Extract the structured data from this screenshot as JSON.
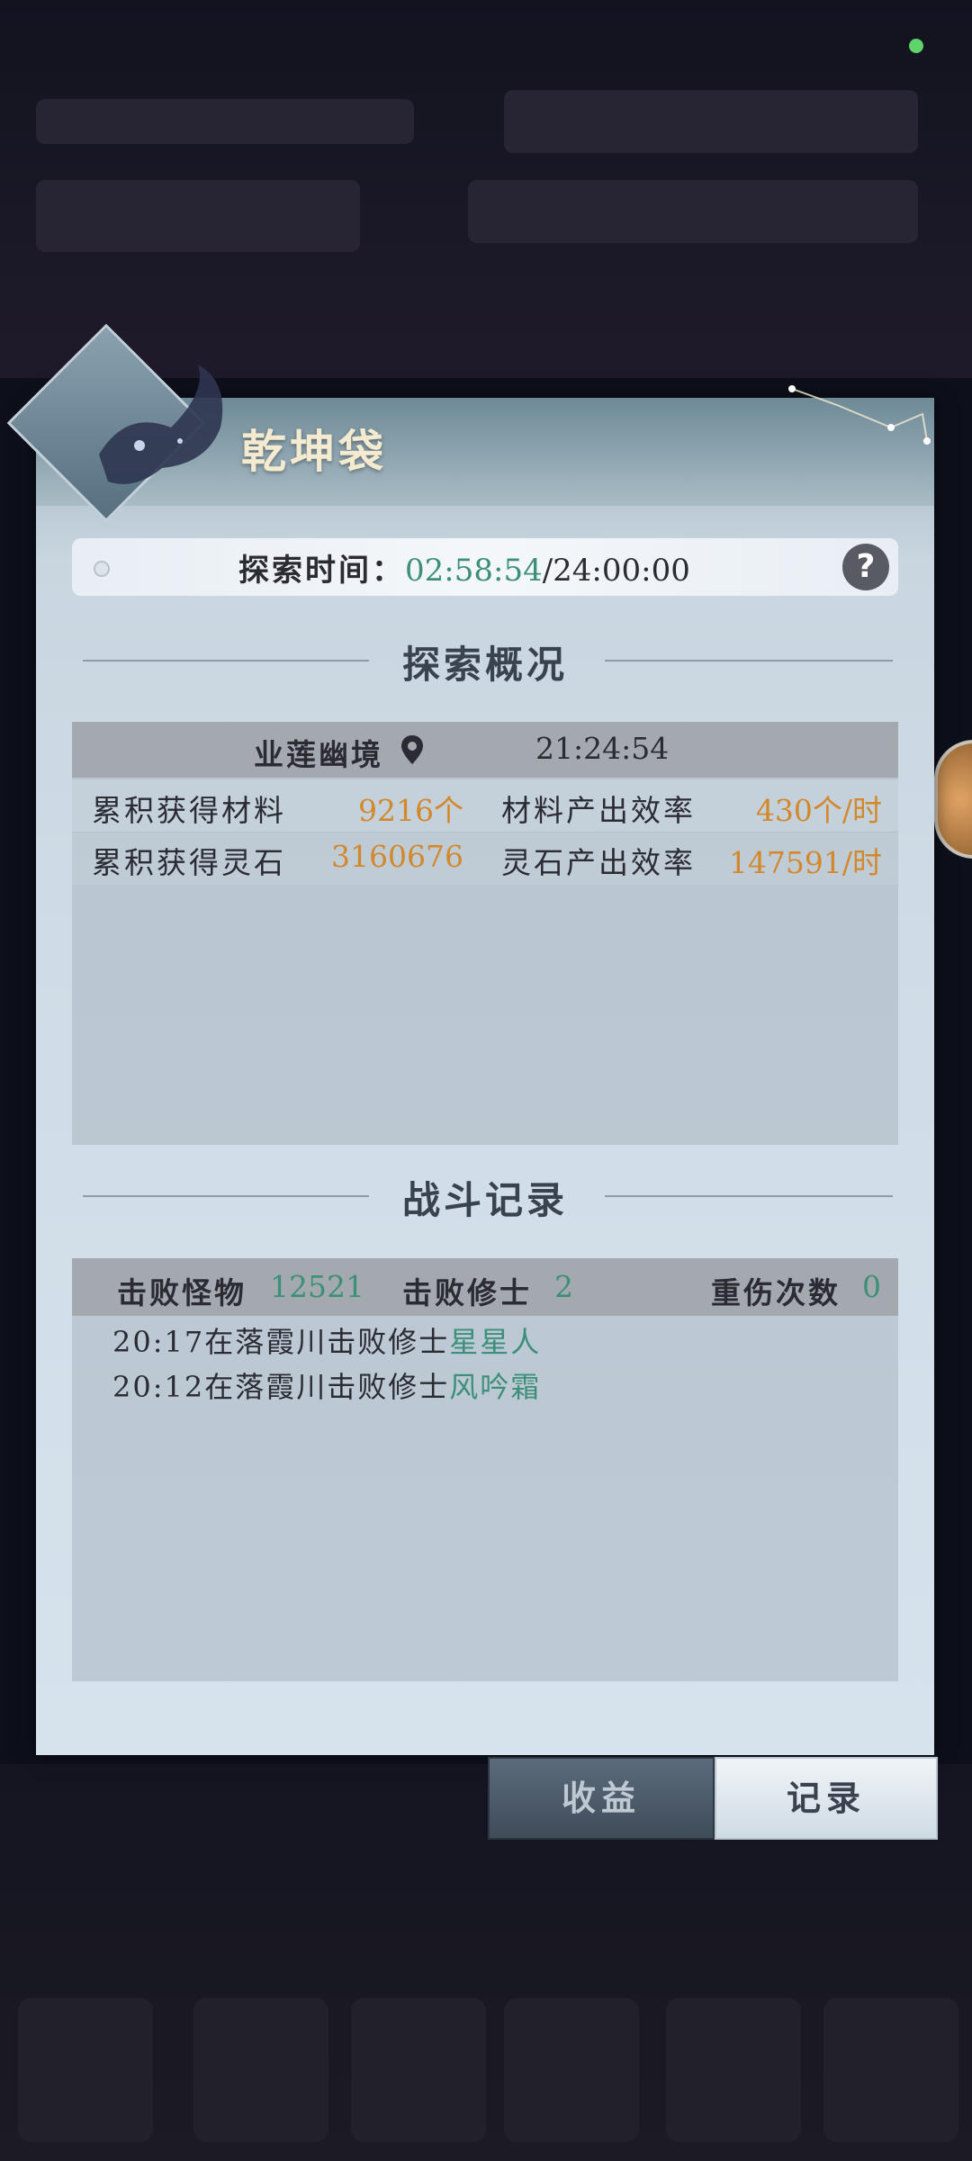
{
  "dialog": {
    "title": "乾坤袋",
    "time_label": "探索时间：",
    "time_current": "02:58:54",
    "time_total": "/24:00:00",
    "help_glyph": "?"
  },
  "overview": {
    "heading": "探索概况",
    "location": "业莲幽境",
    "location_time": "21:24:54",
    "rows": [
      {
        "label": "累积获得材料",
        "value": "9216个",
        "rate_label": "材料产出效率",
        "rate_value": "430个/时"
      },
      {
        "label": "累积获得灵石",
        "value": "3160676",
        "rate_label": "灵石产出效率",
        "rate_value": "147591/时"
      }
    ]
  },
  "combat": {
    "heading": "战斗记录",
    "monsters_label": "击败怪物",
    "monsters_value": "12521",
    "cultivators_label": "击败修士",
    "cultivators_value": "2",
    "injuries_label": "重伤次数",
    "injuries_value": "0",
    "log": [
      {
        "prefix": "20:17在落霞川击败修士",
        "name": "星星人"
      },
      {
        "prefix": "20:12在落霞川击败修士",
        "name": "风吟霜"
      }
    ]
  },
  "tabs": {
    "income": "收益",
    "record": "记录"
  },
  "colors": {
    "accent_green": "#3d8f7a",
    "accent_orange": "#d2882b",
    "status_dot": "#5fd46a"
  },
  "icons": [
    "location-pin-icon",
    "help-icon",
    "radio-dot-icon",
    "fox-emblem-icon",
    "constellation-icon"
  ]
}
